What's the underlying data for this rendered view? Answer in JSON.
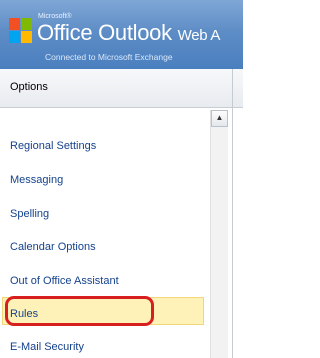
{
  "header": {
    "brand_small": "Microsoft®",
    "product_main": "Office Outlook",
    "product_suffix": "Web A",
    "connected_text": "Connected to Microsoft Exchange"
  },
  "options": {
    "title": "Options"
  },
  "nav": {
    "items": [
      {
        "label": "Regional Settings"
      },
      {
        "label": "Messaging"
      },
      {
        "label": "Spelling"
      },
      {
        "label": "Calendar Options"
      },
      {
        "label": "Out of Office Assistant"
      },
      {
        "label": "Rules"
      },
      {
        "label": "E-Mail Security"
      }
    ],
    "selected": "Rules"
  },
  "scrollbar": {
    "up_icon": "chevron-up-icon"
  },
  "colors": {
    "header_blue": "#4a7fbf",
    "link_blue": "#15428b",
    "selected_bg": "#fef2b8",
    "highlight_red": "#d81f1f"
  }
}
